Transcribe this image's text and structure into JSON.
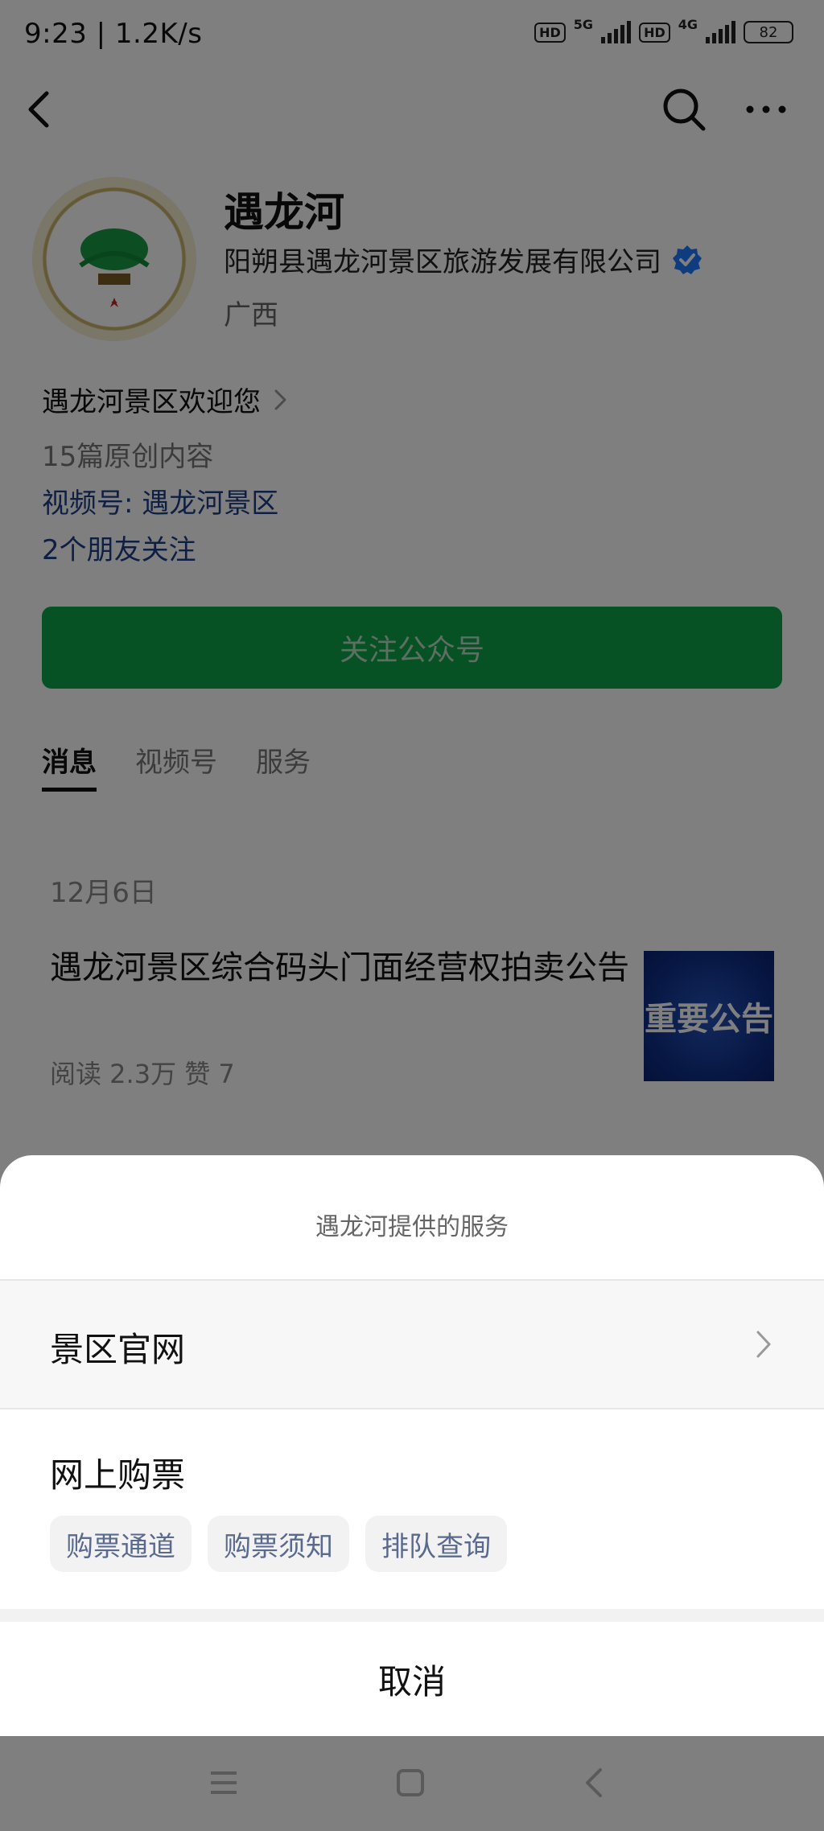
{
  "status_bar": {
    "time": "9:23 | 1.2K/s",
    "net1": "5G",
    "net2": "4G",
    "battery": "82",
    "hd": "HD"
  },
  "account": {
    "name": "遇龙河",
    "company": "阳朔县遇龙河景区旅游发展有限公司",
    "region": "广西",
    "intro": "遇龙河景区欢迎您",
    "articles": "15篇原创内容",
    "channel": "视频号: 遇龙河景区",
    "friends": "2个朋友关注",
    "follow_label": "关注公众号"
  },
  "tabs": [
    {
      "label": "消息"
    },
    {
      "label": "视频号"
    },
    {
      "label": "服务"
    }
  ],
  "feed": {
    "date": "12月6日",
    "title": "遇龙河景区综合码头门面经营权拍卖公告",
    "stats": "阅读 2.3万  赞 7",
    "thumb_text": "重要公告"
  },
  "sheet": {
    "title": "遇龙河提供的服务",
    "official_site": "景区官网",
    "ticketing": "网上购票",
    "pills": [
      "购票通道",
      "购票须知",
      "排队查询"
    ],
    "cancel": "取消"
  },
  "icons": {
    "back": "back-arrow-icon",
    "search": "search-icon",
    "more": "more-icon",
    "verified": "verified-badge-icon",
    "chevron": "chevron-right-icon",
    "menu": "menu-icon",
    "home": "home-icon",
    "sys_back": "system-back-icon"
  },
  "colors": {
    "accent_green": "#0ca44a",
    "link_blue": "#1f3f87",
    "verified_blue": "#1e78ff"
  }
}
